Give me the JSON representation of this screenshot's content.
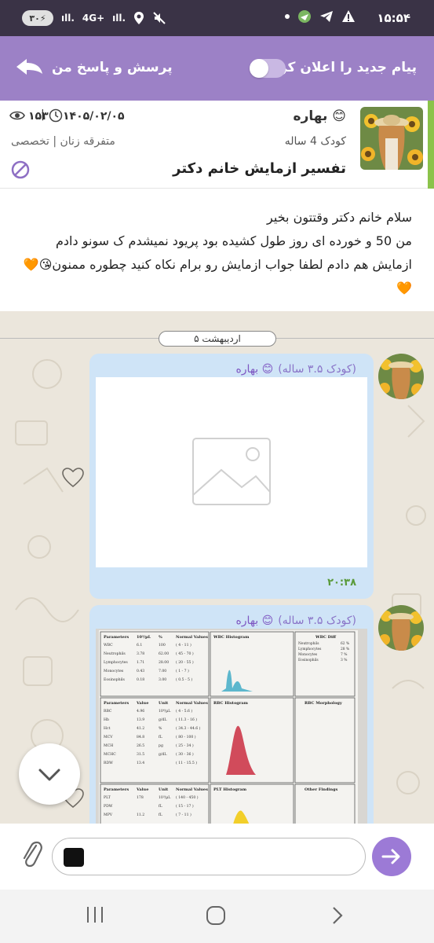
{
  "status_bar": {
    "time": "۱۵:۵۴",
    "battery": "۳۰",
    "network": "4G+"
  },
  "app_bar": {
    "notify_label": "پیام جدید را اعلان کن",
    "notify_toggle_on": false,
    "title": "پرسش و پاسخ من"
  },
  "question": {
    "author": "بهاره 😊",
    "child": "کودک 4 ساله",
    "title": "تفسیر ازمایش خانم دکتر",
    "date": "۱۴۰۵/۰۲/۰۵",
    "separator": "|",
    "views": "۱۵۳",
    "category": "متفرقه زنان | تخصصی",
    "body": "سلام خانم دکتر وقتتون بخیر\nمن 50 و خورده ای روز طول کشیده بود پریود نمیشدم ک سونو دادم ازمایش هم دادم لطفا جواب ازمایش رو برام نکاه کنید چطوره ممنون😘🧡🧡"
  },
  "chat": {
    "date_label": "۵ اردیبهشت",
    "messages": [
      {
        "sender": "بهاره 😊",
        "child": "(کودک ۳.۵ ساله)",
        "attachment": "image-placeholder",
        "time": "۲۰:۳۸"
      },
      {
        "sender": "بهاره 😊",
        "child": "(کودک ۳.۵ ساله)",
        "attachment": "lab-report-photo"
      }
    ]
  },
  "lab_report": {
    "sections": [
      {
        "header": [
          "Parameters",
          "10³/µL",
          "%",
          "Normal Values",
          "WBC Histogram"
        ],
        "rows": [
          [
            "WBC",
            "6.1",
            "100",
            "( 4 - 11 )"
          ],
          [
            "Neutrophils",
            "3.78",
            "62.00",
            "( 45 - 70 )"
          ],
          [
            "Lymphocytes",
            "1.71",
            "28.00",
            "( 20 - 55 )"
          ],
          [
            "Monocytes",
            "0.43",
            "7.00",
            "( 1 - 7 )"
          ],
          [
            "Eosinophils",
            "0.18",
            "3.00",
            "( 0.5 - 5 )"
          ]
        ],
        "diff_title": "WBC Diff",
        "diff": [
          [
            "Neutrophils",
            "62 %"
          ],
          [
            "Lymphocytes",
            "28 %"
          ],
          [
            "Monocytes",
            "7 %"
          ],
          [
            "Eosinophils",
            "3 %"
          ]
        ]
      },
      {
        "header": [
          "Parameters",
          "Value",
          "Unit",
          "Normal Values",
          "RBC Histogram",
          "RBC Morphology"
        ],
        "rows": [
          [
            "RBC",
            "4.96",
            "10⁶/µL",
            "( 4 - 5.6 )"
          ],
          [
            "Hb",
            "13.9",
            "g/dL",
            "( 11.3 - 16 )"
          ],
          [
            "Hct",
            "41.2",
            "%",
            "( 34.3 - 44.6 )"
          ],
          [
            "MCV",
            "84.8",
            "fL",
            "( 80 - 100 )"
          ],
          [
            "MCH",
            "26.5",
            "pg",
            "( 25 - 34 )"
          ],
          [
            "MCHC",
            "31.5",
            "g/dL",
            "( 30 - 36 )"
          ],
          [
            "RDW",
            "13.4",
            "",
            "( 11 - 15.5 )"
          ]
        ]
      },
      {
        "header": [
          "Parameters",
          "Value",
          "Unit",
          "Normal Values",
          "PLT Histogram",
          "Other Findings"
        ],
        "rows": [
          [
            "PLT",
            "178",
            "10³/µL",
            "( 140 - 450 )"
          ],
          [
            "PDW",
            "",
            "fL",
            "( 15 - 17 )"
          ],
          [
            "MPV",
            "11.2",
            "fL",
            "( 7 - 11 )"
          ]
        ]
      }
    ]
  },
  "input": {
    "attach_icon": "paperclip-icon",
    "send_icon": "send-arrow-icon"
  },
  "colors": {
    "app_bar": "#9c81c6",
    "status_bar": "#3a3346",
    "bubble": "#cfe4f7",
    "accent_green": "#8bc34a",
    "chat_bg": "#ebe6dc",
    "send": "#9c7ad6"
  }
}
